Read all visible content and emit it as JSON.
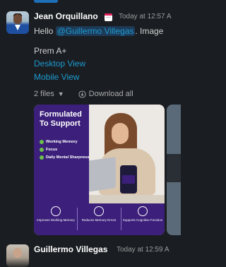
{
  "message1": {
    "sender": "Jean Orquillano",
    "time": "Today at 12:57 A",
    "greeting": "Hello",
    "mention": "@Guillermo Villegas",
    "greeting_tail": ". Image",
    "line1": "Prem A+",
    "link1": "Desktop View",
    "link2": "Mobile View",
    "files_count": "2 files",
    "download_label": "Download all"
  },
  "attachment": {
    "title": "Formulated To Support",
    "benefits": [
      "Working Memory",
      "Focus",
      "Daily Mental Sharpness"
    ],
    "bottle_label": "CELLULAR",
    "features": [
      "Improves Working Memory",
      "Reduces Memory Errors",
      "Supports Cognitive Function"
    ]
  },
  "message2": {
    "sender": "Guillermo Villegas",
    "time": "Today at 12:59 A"
  }
}
